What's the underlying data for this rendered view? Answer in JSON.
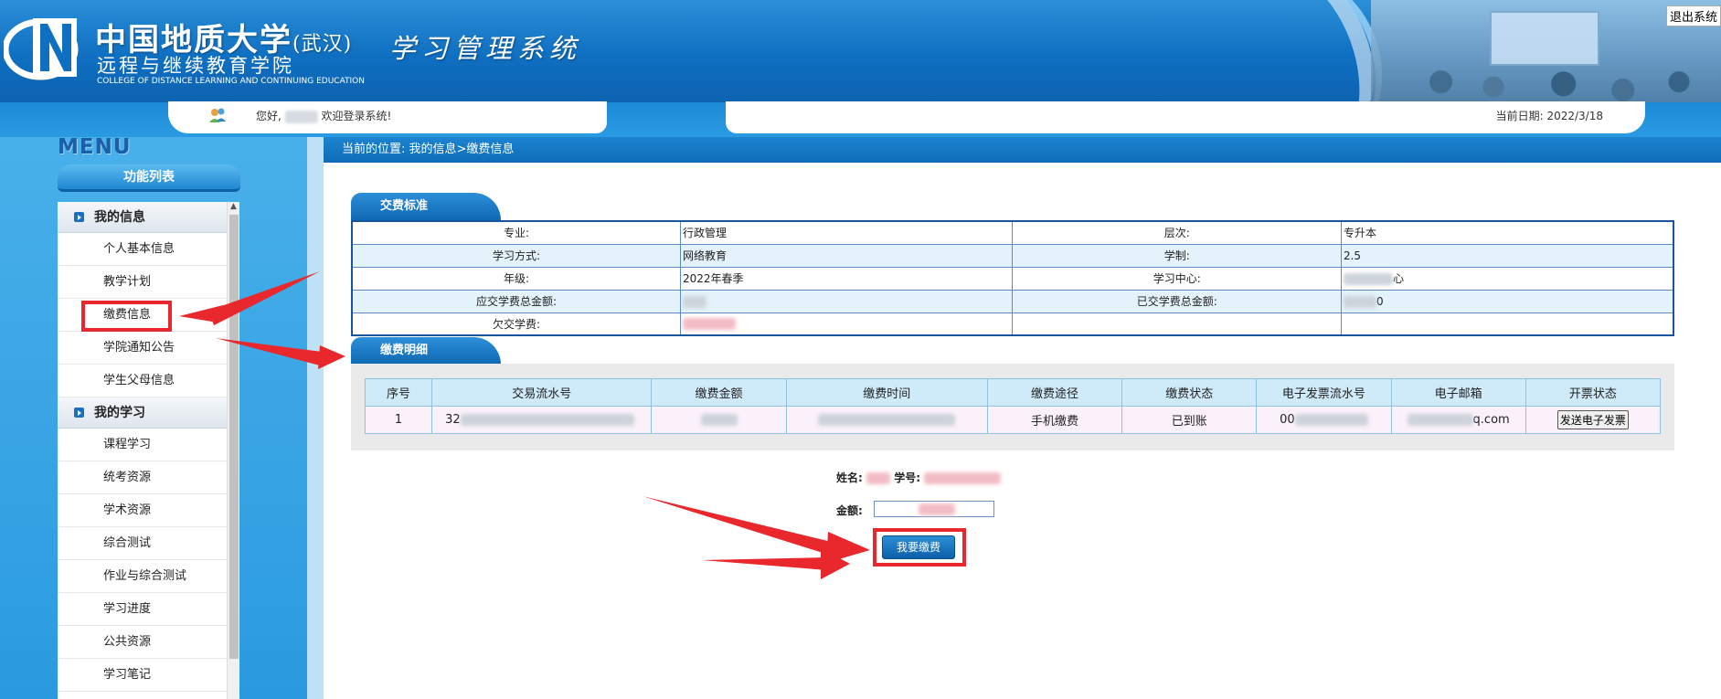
{
  "header": {
    "school_name": "中国地质大学",
    "school_city": "(武汉)",
    "college_name": "远程与继续教育学院",
    "college_en": "COLLEGE OF DISTANCE LEARNING AND CONTINUING EDUCATION",
    "system_name": "学习管理系统",
    "logout_label": "退出系统"
  },
  "topbar": {
    "welcome_prefix": "您好,",
    "welcome_suffix": "欢迎登录系统!",
    "date_text": "当前日期: 2022/3/18"
  },
  "sidebar": {
    "menu_title": "MENU",
    "func_list_title": "功能列表",
    "groups": [
      {
        "label": "我的信息",
        "items": [
          "个人基本信息",
          "教学计划",
          "缴费信息",
          "学院通知公告",
          "学生父母信息"
        ]
      },
      {
        "label": "我的学习",
        "items": [
          "课程学习",
          "统考资源",
          "学术资源",
          "综合测试",
          "作业与综合测试",
          "学习进度",
          "公共资源",
          "学习笔记"
        ]
      }
    ]
  },
  "breadcrumb": "当前的位置: 我的信息>缴费信息",
  "fee_standard": {
    "section_title": "交费标准",
    "rows": [
      {
        "l1": "专业:",
        "v1": "行政管理",
        "l2": "层次:",
        "v2": "专升本"
      },
      {
        "l1": "学习方式:",
        "v1": "网络教育",
        "l2": "学制:",
        "v2": "2.5"
      },
      {
        "l1": "年级:",
        "v1": "2022年春季",
        "l2": "学习中心:",
        "v2": "心"
      },
      {
        "l1": "应交学费总金额:",
        "v1": "",
        "l2": "已交学费总金额:",
        "v2": "0"
      },
      {
        "l1": "欠交学费:",
        "v1": "",
        "l2": "",
        "v2": ""
      }
    ]
  },
  "payment_detail": {
    "section_title": "缴费明细",
    "headers": [
      "序号",
      "交易流水号",
      "缴费金额",
      "缴费时间",
      "缴费途径",
      "缴费状态",
      "电子发票流水号",
      "电子邮箱",
      "开票状态"
    ],
    "rows": [
      {
        "index": "1",
        "serial_prefix": "32",
        "amount": "",
        "time": "",
        "channel": "手机缴费",
        "status": "已到账",
        "invoice_prefix": "00",
        "email_suffix": "q.com",
        "invoice_button": "发送电子发票"
      }
    ]
  },
  "pay_form": {
    "name_label": "姓名:",
    "id_label": "学号:",
    "amount_label": "金额:",
    "pay_button": "我要缴费"
  }
}
